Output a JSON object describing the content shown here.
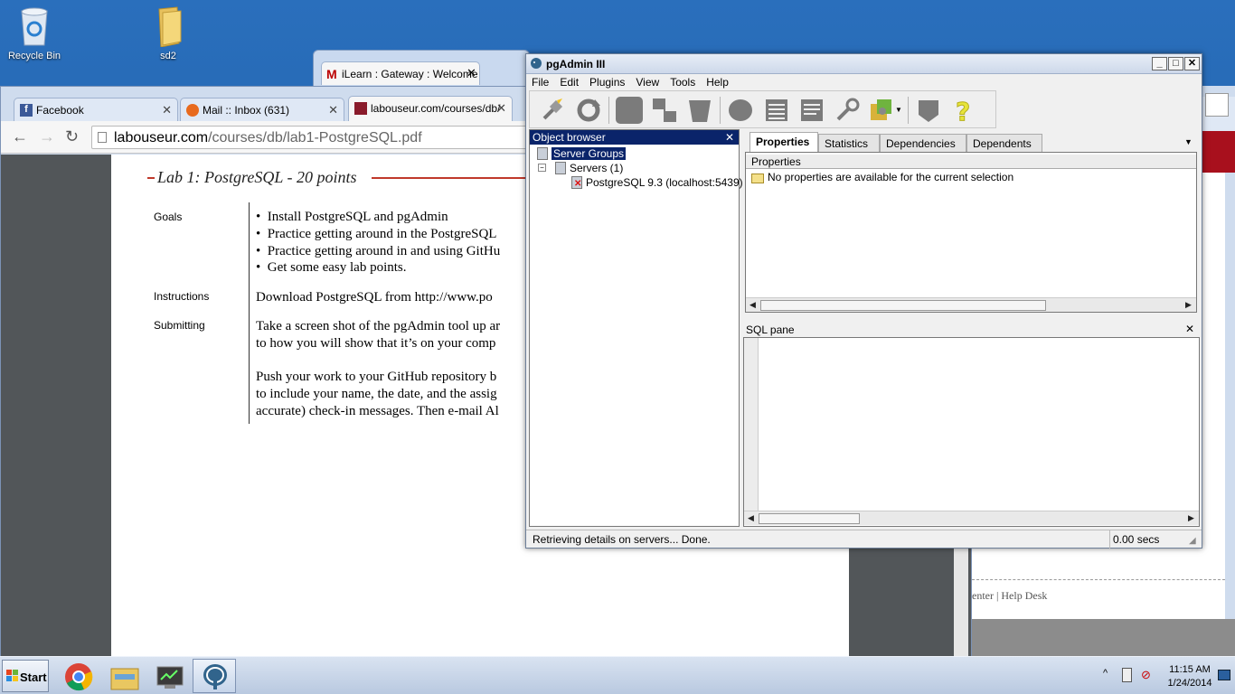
{
  "desktop": {
    "icons": [
      {
        "label": "Recycle Bin",
        "icon": "recycle-bin-icon"
      },
      {
        "label": "sd2",
        "icon": "folder-icon"
      }
    ]
  },
  "ilearn_window": {
    "tab_label": "iLearn : Gateway : Welcome"
  },
  "chrome": {
    "tabs": [
      {
        "label": "Facebook",
        "icon": "facebook-icon"
      },
      {
        "label": "Mail :: Inbox (631)",
        "icon": "mail-icon"
      },
      {
        "label": "labouseur.com/courses/db/",
        "icon": "pdf-icon"
      }
    ],
    "url_host": "labouseur.com",
    "url_path": "/courses/db/lab1-PostgreSQL.pdf"
  },
  "pdf": {
    "title": "Lab 1: PostgreSQL - 20 points",
    "goals_label": "Goals",
    "goals": [
      "Install PostgreSQL and pgAdmin",
      "Practice getting around in the PostgreSQL",
      "Practice getting around in and using GitHu",
      "Get some easy lab points."
    ],
    "instructions_label": "Instructions",
    "instructions_text": "Download PostgreSQL from http://www.po",
    "submitting_label": "Submitting",
    "submitting_lines": [
      "Take a screen shot of the pgAdmin tool up ar",
      "to how you will show that it’s on your comp",
      "Push your work to your GitHub repository b",
      "to include your name, the date, and the assig",
      "accurate) check-in messages. Then e-mail Al"
    ]
  },
  "background_text": {
    "help_desk": "enter | Help Desk"
  },
  "pgadmin": {
    "title": "pgAdmin III",
    "menu": [
      "File",
      "Edit",
      "Plugins",
      "View",
      "Tools",
      "Help"
    ],
    "object_browser": {
      "caption": "Object browser",
      "server_groups": "Server Groups",
      "servers": "Servers (1)",
      "server": "PostgreSQL 9.3 (localhost:5439)"
    },
    "tabs": [
      "Properties",
      "Statistics",
      "Dependencies",
      "Dependents"
    ],
    "properties": {
      "header": "Properties",
      "message": "No properties are available for the current selection"
    },
    "sql_pane": {
      "caption": "SQL pane"
    },
    "status": {
      "message": "Retrieving details on servers... Done.",
      "time": "0.00 secs"
    }
  },
  "taskbar": {
    "start_label": "Start",
    "time": "11:15 AM",
    "date": "1/24/2014"
  }
}
